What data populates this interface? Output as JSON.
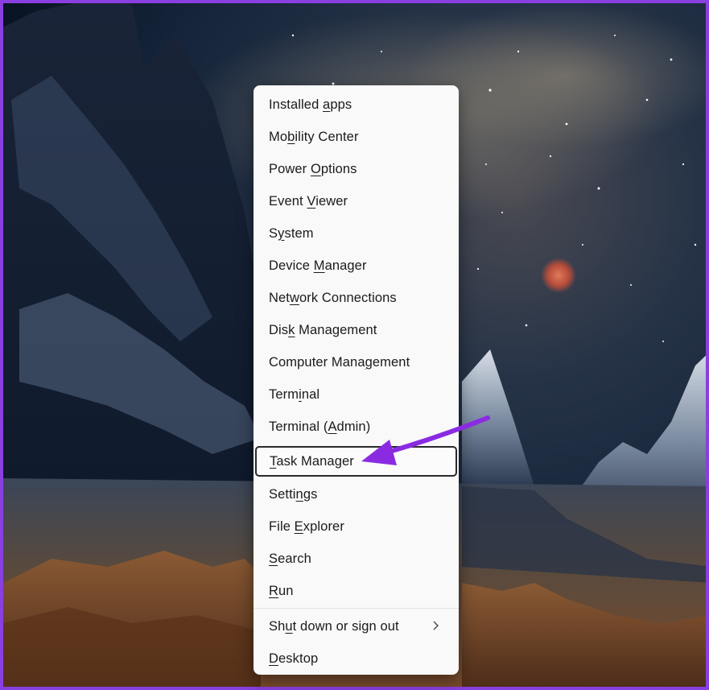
{
  "menu": {
    "items": [
      {
        "pre": "Installed ",
        "key": "a",
        "post": "pps"
      },
      {
        "pre": "Mo",
        "key": "b",
        "post": "ility Center"
      },
      {
        "pre": "Power ",
        "key": "O",
        "post": "ptions"
      },
      {
        "pre": "Event ",
        "key": "V",
        "post": "iewer"
      },
      {
        "pre": "S",
        "key": "y",
        "post": "stem"
      },
      {
        "pre": "Device ",
        "key": "M",
        "post": "anager"
      },
      {
        "pre": "Net",
        "key": "w",
        "post": "ork Connections"
      },
      {
        "pre": "Dis",
        "key": "k",
        "post": " Management"
      },
      {
        "pre": "Computer Mana",
        "key": "g",
        "post": "ement"
      },
      {
        "pre": "Term",
        "key": "i",
        "post": "nal"
      },
      {
        "pre": "Terminal (",
        "key": "A",
        "post": "dmin)"
      },
      {
        "pre": "",
        "key": "T",
        "post": "ask Manager"
      },
      {
        "pre": "Setti",
        "key": "n",
        "post": "gs"
      },
      {
        "pre": "File ",
        "key": "E",
        "post": "xplorer"
      },
      {
        "pre": "",
        "key": "S",
        "post": "earch"
      },
      {
        "pre": "",
        "key": "R",
        "post": "un"
      },
      {
        "pre": "Sh",
        "key": "u",
        "post": "t down or sign out"
      },
      {
        "pre": "",
        "key": "D",
        "post": "esktop"
      }
    ],
    "highlighted_item": "Task Manager",
    "submenu_icon": "chevron-right-icon"
  },
  "annotation": {
    "arrow_color": "#8a2be2",
    "frame_color": "#8a3fe0"
  }
}
